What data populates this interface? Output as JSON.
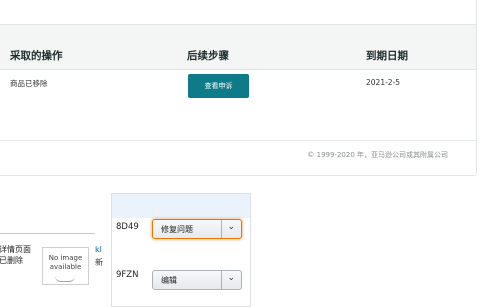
{
  "table": {
    "headers": [
      "采取的操作",
      "后续步骤",
      "到期日期"
    ],
    "row": {
      "action": "商品已移除",
      "button_label": "查看申诉",
      "due_date": "2021-2-5"
    }
  },
  "footer": {
    "copyright": "© 1999-2020 年，亚马逊公司或其附属公司"
  },
  "listing": {
    "detail_line1": "详情页面",
    "detail_line2": "已删除",
    "no_image_line1": "No image",
    "no_image_line2": "available",
    "link_fragment": "kl",
    "text_fragment": "新"
  },
  "actions": [
    {
      "sku": "8D49",
      "dropdown": "修复问题",
      "focused": true
    },
    {
      "sku": "9FZN",
      "dropdown": "编辑",
      "focused": false
    }
  ],
  "colors": {
    "primary_button": "#0f7b89",
    "focus_ring": "#e77600"
  }
}
